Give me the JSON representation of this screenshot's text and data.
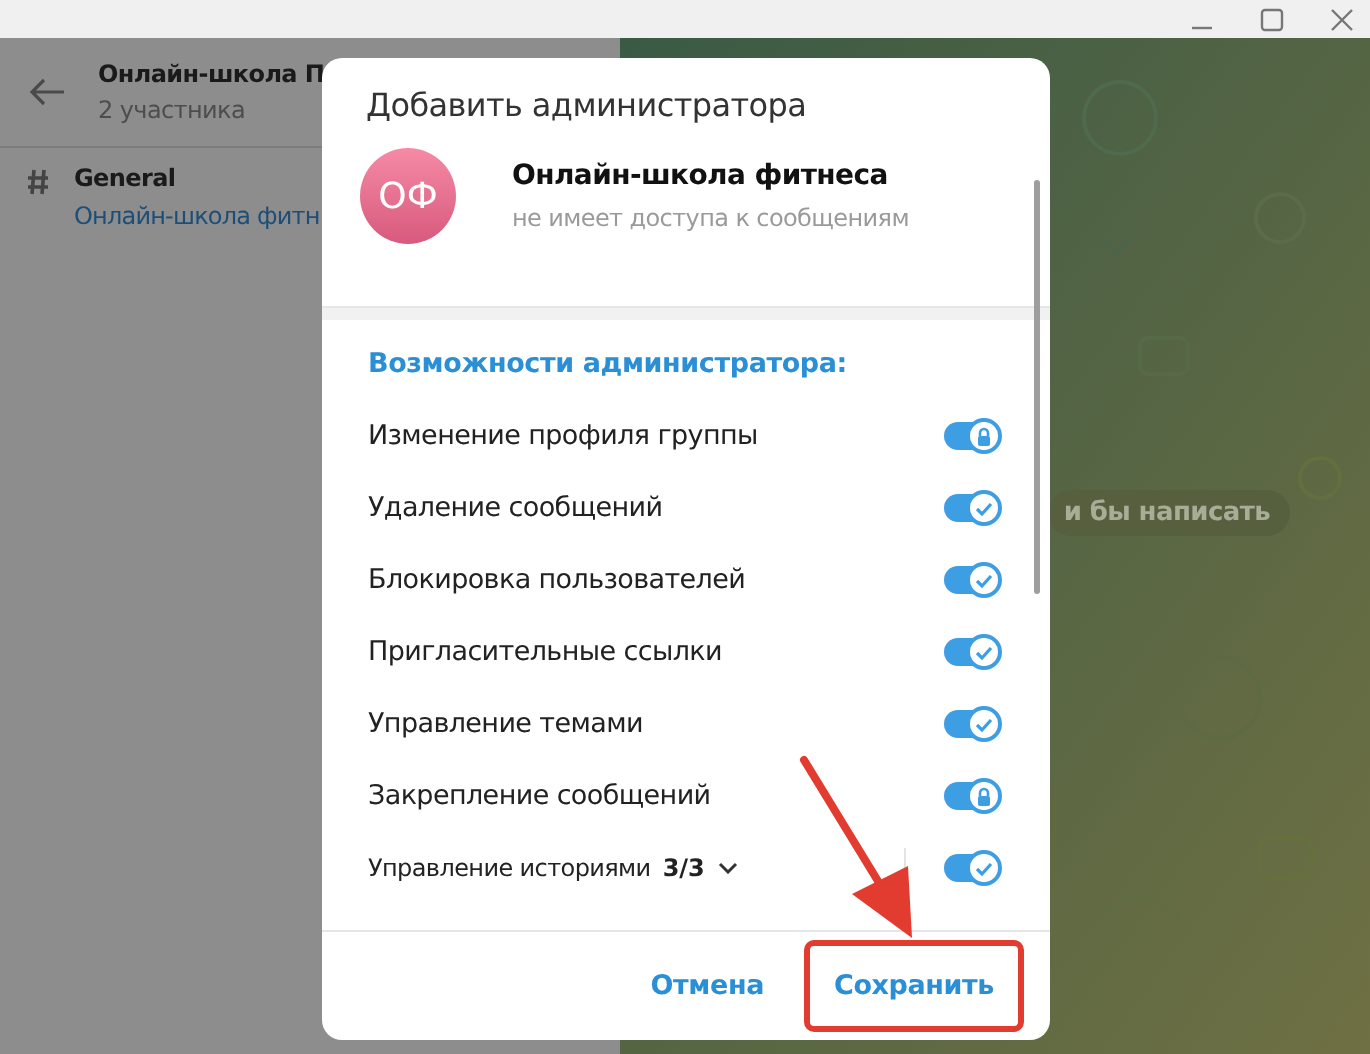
{
  "group": {
    "title": "Онлайн-школа П",
    "subtitle": "2 участника"
  },
  "topics": [
    {
      "name": "General",
      "preview": "Онлайн-школа фитн"
    }
  ],
  "chat": {
    "hint": "и бы написать"
  },
  "dialog": {
    "title": "Добавить администратора",
    "avatar_initials": "ОФ",
    "name": "Онлайн-школа фитнеса",
    "status": "не имеет доступа к сообщениям",
    "section": "Возможности администратора:",
    "rights": [
      {
        "kind": "toggle",
        "label": "Изменение профиля группы",
        "on": true,
        "locked": true
      },
      {
        "kind": "toggle",
        "label": "Удаление сообщений",
        "on": true,
        "locked": false
      },
      {
        "kind": "toggle",
        "label": "Блокировка пользователей",
        "on": true,
        "locked": false
      },
      {
        "kind": "toggle",
        "label": "Пригласительные ссылки",
        "on": true,
        "locked": false
      },
      {
        "kind": "toggle",
        "label": "Управление темами",
        "on": true,
        "locked": false
      },
      {
        "kind": "toggle",
        "label": "Закрепление сообщений",
        "on": true,
        "locked": true
      },
      {
        "kind": "expandable",
        "label": "Управление историями",
        "count": "3/3",
        "on": true,
        "locked": false
      }
    ],
    "buttons": [
      {
        "label": "Отмена",
        "highlighted": false
      },
      {
        "label": "Сохранить",
        "highlighted": true
      }
    ]
  }
}
